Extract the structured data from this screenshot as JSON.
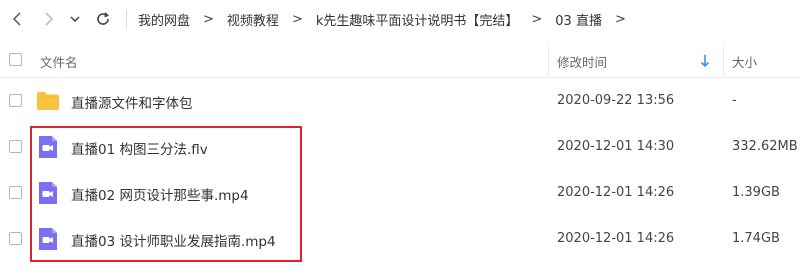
{
  "nav": {
    "back_icon": "chevron-left-icon",
    "forward_icon": "chevron-right-icon",
    "refresh_icon": "refresh-icon",
    "breadcrumbs": [
      "我的网盘",
      "视频教程",
      "k先生趣味平面设计说明书【完结】",
      "03 直播"
    ],
    "separator": ">"
  },
  "header": {
    "name_label": "文件名",
    "date_label": "修改时间",
    "size_label": "大小",
    "sort_icon": "sort-arrow-down-icon"
  },
  "files": [
    {
      "name": "直播源文件和字体包",
      "date": "2020-09-22 13:56",
      "size": "-",
      "icon": "folder-icon"
    },
    {
      "name": "直播01 构图三分法.flv",
      "date": "2020-12-01 14:30",
      "size": "332.62MB",
      "icon": "video-file-icon"
    },
    {
      "name": "直播02 网页设计那些事.mp4",
      "date": "2020-12-01 14:26",
      "size": "1.39GB",
      "icon": "video-file-icon"
    },
    {
      "name": "直播03 设计师职业发展指南.mp4",
      "date": "2020-12-01 14:26",
      "size": "1.74GB",
      "icon": "video-file-icon"
    }
  ],
  "colors": {
    "folder": "#f7c33c",
    "video_icon": "#7b6ff5",
    "sort_arrow": "#3e8ef7",
    "highlight": "#e0212a"
  }
}
